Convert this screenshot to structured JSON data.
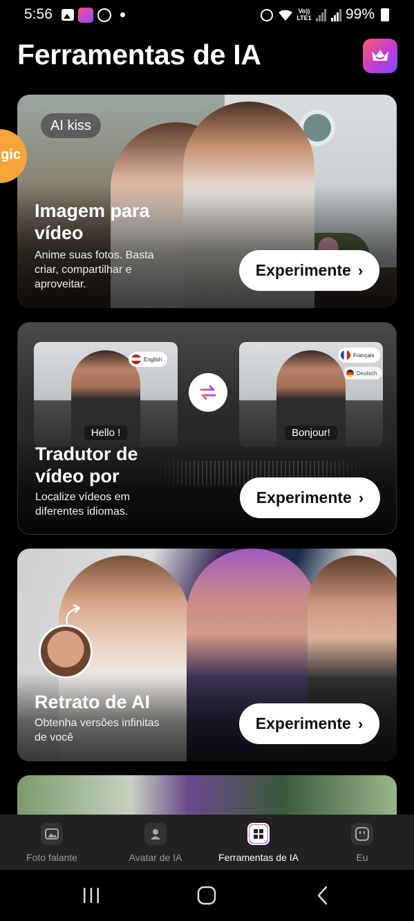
{
  "status_bar": {
    "time": "5:56",
    "battery": "99%",
    "volte": "Vo)) LTE1"
  },
  "header": {
    "title": "Ferramentas de IA",
    "premium_icon": "crown-icon"
  },
  "side_tab": {
    "label": "gic"
  },
  "cards": [
    {
      "chip": "AI kiss",
      "title_line1": "Imagem para",
      "title_line2": "vídeo",
      "desc_line1": "Anime suas fotos. Basta",
      "desc_line2": "criar, compartilhar e",
      "desc_line3": "aproveitar.",
      "button": "Experimente"
    },
    {
      "title_line1": "Tradutor de",
      "title_line2": "vídeo por",
      "desc_line1": "Localize vídeos em",
      "desc_line2": "diferentes idiomas.",
      "button": "Experimente",
      "source_caption": "Hello !",
      "target_caption": "Bonjour!",
      "source_lang": "English",
      "target_lang": "Français",
      "extra_lang": "Deutsch"
    },
    {
      "title_line1": "Retrato de AI",
      "desc_line1": "Obtenha versões infinitas",
      "desc_line2": "de você",
      "button": "Experimente"
    }
  ],
  "bottom_nav": [
    {
      "label": "Foto falante",
      "icon": "image-icon",
      "active": false
    },
    {
      "label": "Avatar de IA",
      "icon": "avatar-icon",
      "active": false
    },
    {
      "label": "Ferramentas de IA",
      "icon": "grid-icon",
      "active": true
    },
    {
      "label": "Eu",
      "icon": "profile-face-icon",
      "active": false
    }
  ],
  "colors": {
    "accent_orange": "#f8a43a",
    "premium_gradient": [
      "#ff5a6b",
      "#c33bd6",
      "#7b4dff"
    ]
  }
}
